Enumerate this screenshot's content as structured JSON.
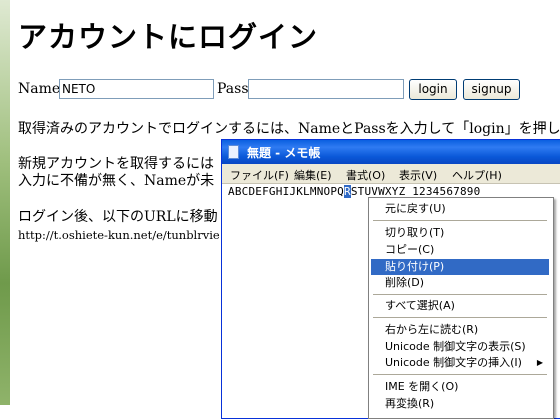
{
  "page": {
    "title": "アカウントにログイン",
    "name_label": "Name:",
    "name_value": "NETO",
    "pass_label": "Pass:",
    "pass_value": "",
    "login_button": "login",
    "signup_button": "signup",
    "para1": "取得済みのアカウントでログインするには、NameとPassを入力して「login」を押してく",
    "para2_line1": "新規アカウントを取得するには",
    "para2_line2": "入力に不備が無く、Nameが未",
    "para3": "ログイン後、以下のURLに移動",
    "url": "http://t.oshiete-kun.net/e/tunblrvie"
  },
  "notepad": {
    "title": "無題 - メモ帳",
    "menus": [
      "ファイル(F)",
      "編集(E)",
      "書式(O)",
      "表示(V)",
      "ヘルプ(H)"
    ],
    "text_before": "ABCDEFGHIJKLMNOPQ",
    "text_selected": "R",
    "text_after": "STUVWXYZ 1234567890"
  },
  "context_menu": {
    "items": [
      {
        "label": "元に戻す(U)",
        "selected": false
      },
      {
        "label": "切り取り(T)",
        "selected": false
      },
      {
        "label": "コピー(C)",
        "selected": false
      },
      {
        "label": "貼り付け(P)",
        "selected": true
      },
      {
        "label": "削除(D)",
        "selected": false
      },
      {
        "label": "すべて選択(A)",
        "selected": false
      },
      {
        "label": "右から左に読む(R)",
        "selected": false
      },
      {
        "label": "Unicode 制御文字の表示(S)",
        "selected": false
      },
      {
        "label": "Unicode 制御文字の挿入(I)",
        "selected": false,
        "submenu": true
      },
      {
        "label": "IME を開く(O)",
        "selected": false
      },
      {
        "label": "再変換(R)",
        "selected": false
      }
    ]
  },
  "colors": {
    "title_bar": "#0a58d8",
    "selection": "#316ac5",
    "menu_bg": "#ece9d8"
  }
}
